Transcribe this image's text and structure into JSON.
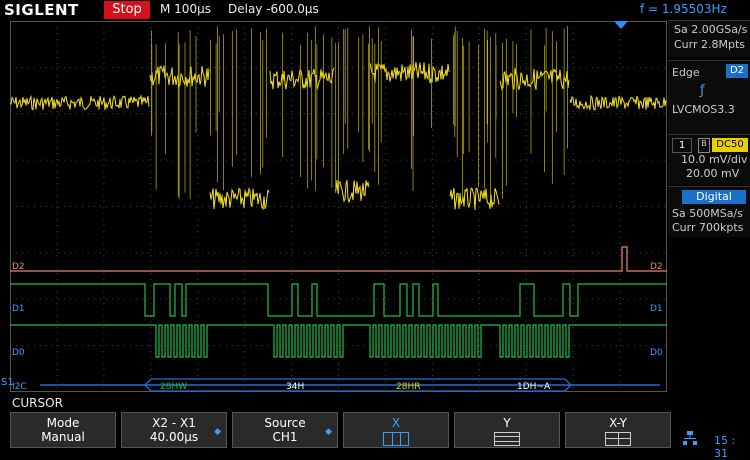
{
  "header": {
    "brand": "SIGLENT",
    "run_state": "Stop",
    "timebase": "M 100μs",
    "delay": "Delay -600.0μs",
    "frequency": "f = 1.95503Hz"
  },
  "acquisition": {
    "sample_rate": "Sa 2.00GSa/s",
    "memory_depth": "Curr 2.8Mpts"
  },
  "trigger": {
    "type": "Edge",
    "source": "D2",
    "slope_icon": "rising-edge-icon",
    "level": "LVCMOS3.3"
  },
  "channel1": {
    "number": "1",
    "coupling": "DC50",
    "scale": "10.0 mV/div",
    "offset": "20.00 mV"
  },
  "digital": {
    "label": "Digital",
    "sample_rate": "Sa 500MSa/s",
    "memory_depth": "Curr 700kpts"
  },
  "traces": {
    "d2_label": "D2",
    "d1_label": "D1",
    "d0_label": "D0",
    "d2_label_right": "D2",
    "d1_label_right": "D1",
    "d0_label_right": "D0"
  },
  "decode": {
    "bus": "I2C",
    "bus_marker": "S1",
    "frames": [
      "28HW",
      "34H",
      "28HR",
      "1DH~A"
    ]
  },
  "menu": {
    "title": "CURSOR",
    "mode": {
      "label": "Mode",
      "value": "Manual"
    },
    "delta": {
      "label": "X2 - X1",
      "value": "40.00μs"
    },
    "source": {
      "label": "Source",
      "value": "CH1"
    },
    "x": {
      "label": "X"
    },
    "y": {
      "label": "Y"
    },
    "xy": {
      "label": "X-Y"
    }
  },
  "status": {
    "clock": "15 : 31"
  },
  "colors": {
    "ch1": "#f5e11c",
    "d2": "#e8877a",
    "d1": "#1fbf4a",
    "d0": "#1fbf4a",
    "accent": "#37a0ff",
    "stop": "#d4101a"
  }
}
